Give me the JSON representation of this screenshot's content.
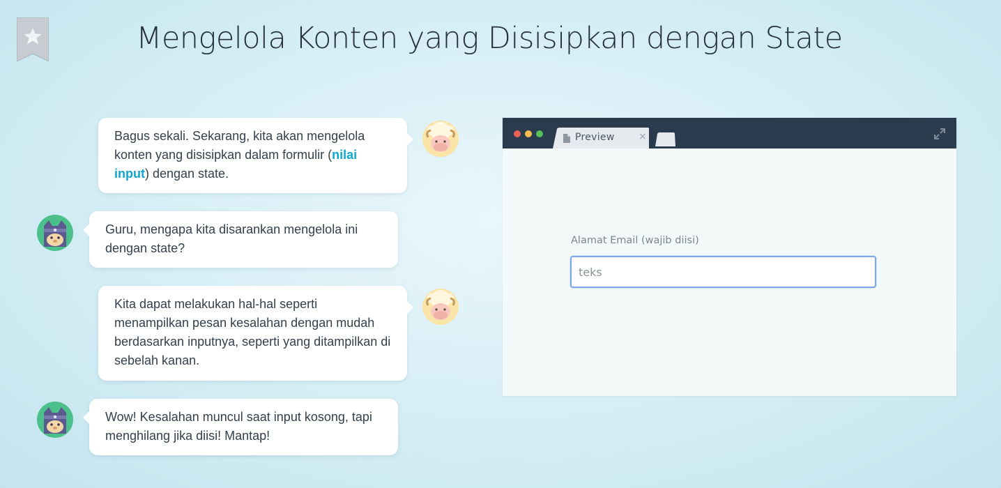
{
  "page": {
    "title": "Mengelola Konten yang Disisipkan dengan State"
  },
  "chat": {
    "messages": [
      {
        "speaker": "teacher",
        "parts": [
          "Bagus sekali. Sekarang, kita akan mengelola konten yang disisipkan dalam formulir (",
          "nilai input",
          ") dengan state."
        ]
      },
      {
        "speaker": "student",
        "text": "Guru, mengapa kita disarankan mengelola ini dengan state?"
      },
      {
        "speaker": "teacher",
        "text": "Kita dapat melakukan hal-hal seperti menampilkan pesan kesalahan dengan mudah berdasarkan inputnya, seperti yang ditampilkan di sebelah kanan."
      },
      {
        "speaker": "student",
        "text": "Wow! Kesalahan muncul saat input kosong, tapi menghilang jika diisi! Mantap!"
      }
    ]
  },
  "preview": {
    "tab_label": "Preview",
    "tab_close": "×",
    "form": {
      "email_label": "Alamat Email (wajib diisi)",
      "email_placeholder": "teks",
      "email_value": ""
    }
  },
  "colors": {
    "accent": "#0fa7cf",
    "browser_bar": "#2b3b4e",
    "input_focus": "#7da7e6"
  },
  "icons": {
    "bookmark": "star-bookmark-icon",
    "teacher_avatar": "sheep-avatar",
    "student_avatar": "cat-ninja-avatar",
    "tab": "document-icon",
    "expand": "expand-icon"
  }
}
